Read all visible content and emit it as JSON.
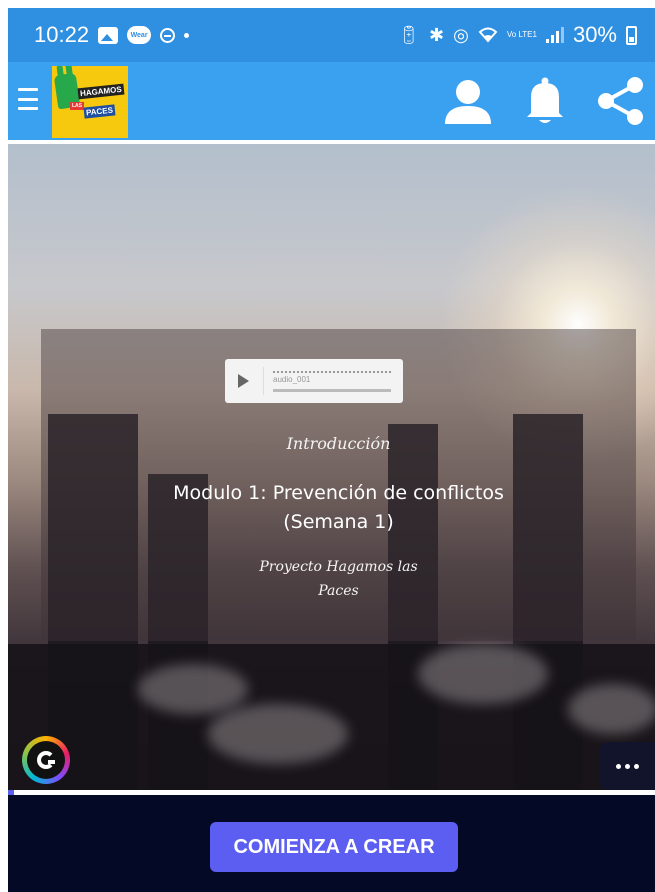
{
  "status_bar": {
    "time": "10:22",
    "battery_text": "30%",
    "battery_level": 0.3,
    "network_label": "Vo LTE1",
    "icons": [
      "gallery-icon",
      "wear-icon",
      "dnd-icon",
      "dot-icon",
      "battery-saver-icon",
      "bluetooth-icon",
      "nfc-icon",
      "wifi-icon",
      "volte-icon",
      "signal-icon",
      "battery-icon"
    ]
  },
  "app_bar": {
    "menu_icon": "hamburger-icon",
    "logo_text": {
      "line1": "HAGAMOS",
      "line2": "LAS",
      "line3": "PACES"
    },
    "actions": [
      "user-icon",
      "bell-icon",
      "share-icon"
    ]
  },
  "hero": {
    "audio": {
      "filename": "audio_001",
      "play_icon": "play-icon"
    },
    "intro": "Introducción",
    "title_line1": "Modulo 1: Prevención de conflictos",
    "title_line2": "(Semana 1)",
    "project_line1": "Proyecto Hagamos las",
    "project_line2": "Paces",
    "badge_icon": "genially-logo-icon",
    "more_icon": "more-horizontal-icon",
    "progress": 0.01
  },
  "footer": {
    "cta_label": "COMIENZA A CREAR"
  },
  "colors": {
    "status_bar": "#2f8fe0",
    "app_bar": "#3aa0f0",
    "footer": "#040a26",
    "cta": "#5b5ef0",
    "progress": "#5a5ff0"
  }
}
